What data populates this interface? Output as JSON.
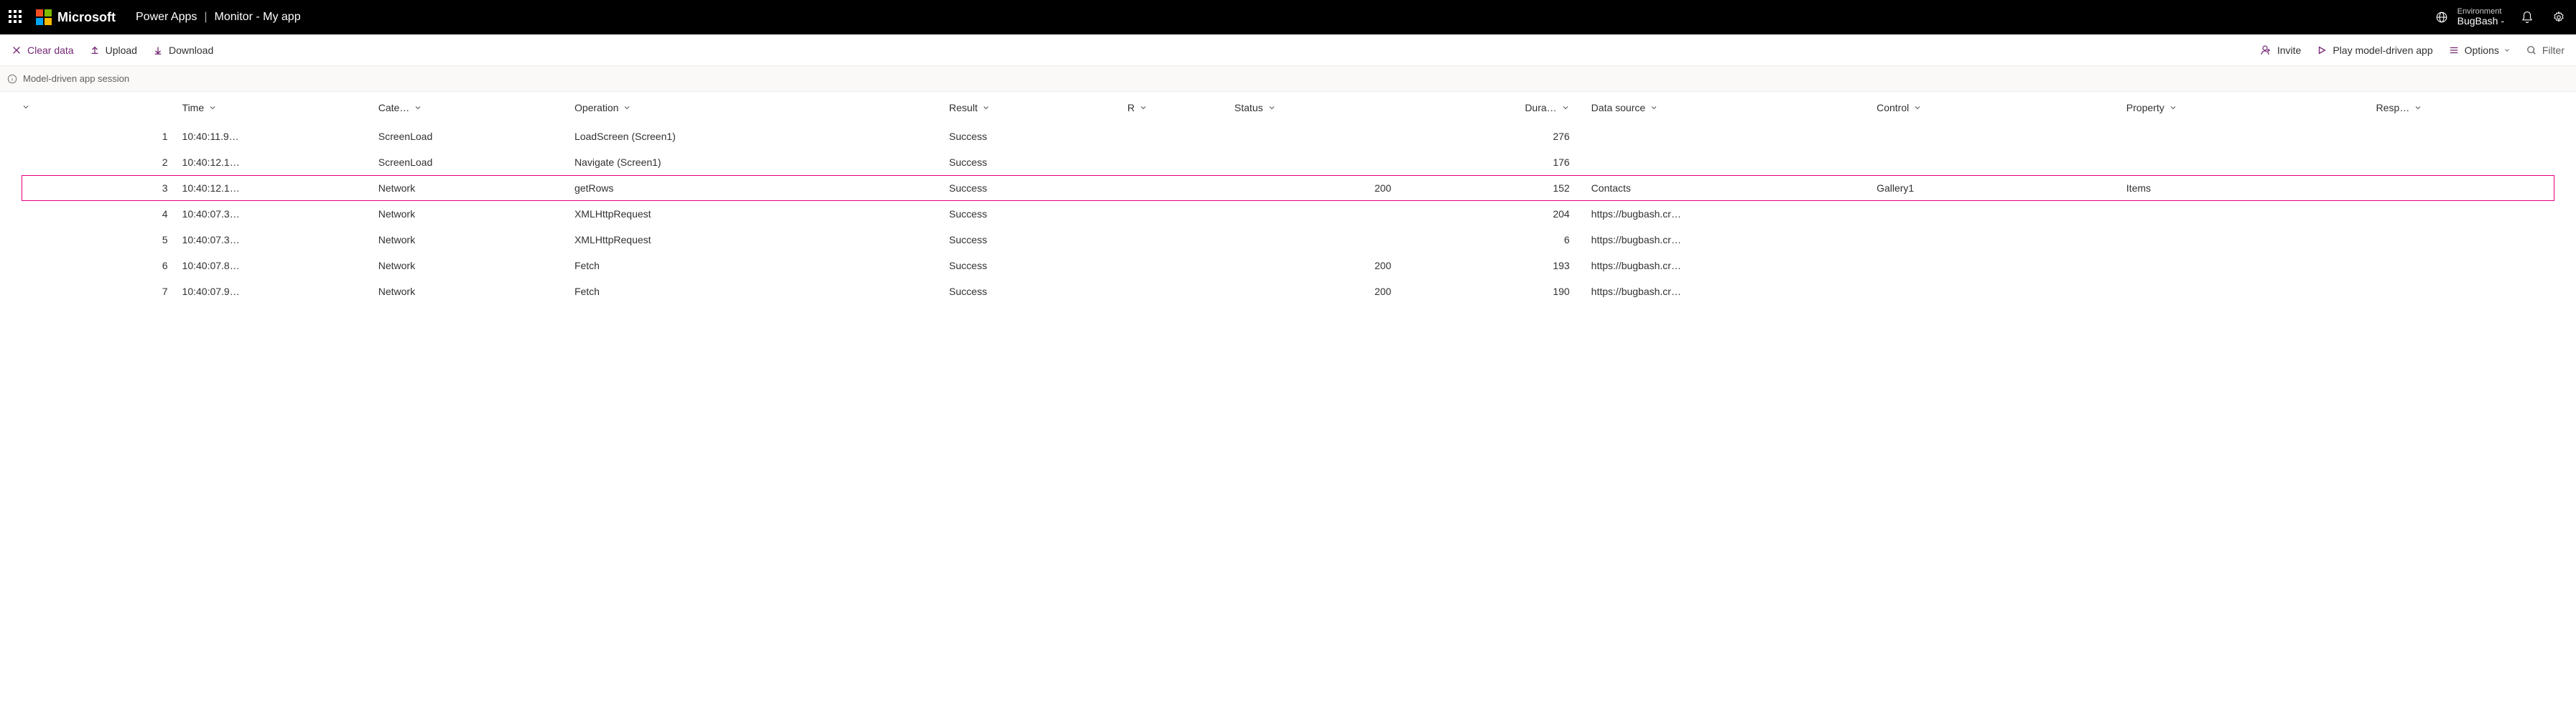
{
  "topbar": {
    "brand": "Microsoft",
    "app": "Power Apps",
    "page": "Monitor - My app",
    "env_label": "Environment",
    "env_name": "BugBash -"
  },
  "cmdbar": {
    "clear": "Clear data",
    "upload": "Upload",
    "download": "Download",
    "invite": "Invite",
    "play": "Play model-driven app",
    "options": "Options",
    "filter": "Filter"
  },
  "session": {
    "label": "Model-driven app session"
  },
  "table": {
    "headers": {
      "idx": "",
      "time": "Time",
      "category": "Cate…",
      "operation": "Operation",
      "result": "Result",
      "r": "R",
      "status": "Status",
      "duration": "Dura…",
      "datasource": "Data source",
      "control": "Control",
      "property": "Property",
      "response": "Resp…"
    },
    "rows": [
      {
        "idx": "1",
        "time": "10:40:11.9…",
        "category": "ScreenLoad",
        "operation": "LoadScreen (Screen1)",
        "result": "Success",
        "status": "",
        "duration": "276",
        "datasource": "",
        "control": "",
        "property": ""
      },
      {
        "idx": "2",
        "time": "10:40:12.1…",
        "category": "ScreenLoad",
        "operation": "Navigate (Screen1)",
        "result": "Success",
        "status": "",
        "duration": "176",
        "datasource": "",
        "control": "",
        "property": ""
      },
      {
        "idx": "3",
        "time": "10:40:12.1…",
        "category": "Network",
        "operation": "getRows",
        "result": "Success",
        "status": "200",
        "duration": "152",
        "datasource": "Contacts",
        "control": "Gallery1",
        "property": "Items",
        "highlight": true
      },
      {
        "idx": "4",
        "time": "10:40:07.3…",
        "category": "Network",
        "operation": "XMLHttpRequest",
        "result": "Success",
        "status": "",
        "duration": "204",
        "datasource": "https://bugbash.cr…",
        "control": "",
        "property": ""
      },
      {
        "idx": "5",
        "time": "10:40:07.3…",
        "category": "Network",
        "operation": "XMLHttpRequest",
        "result": "Success",
        "status": "",
        "duration": "6",
        "datasource": "https://bugbash.cr…",
        "control": "",
        "property": ""
      },
      {
        "idx": "6",
        "time": "10:40:07.8…",
        "category": "Network",
        "operation": "Fetch",
        "result": "Success",
        "status": "200",
        "duration": "193",
        "datasource": "https://bugbash.cr…",
        "control": "",
        "property": ""
      },
      {
        "idx": "7",
        "time": "10:40:07.9…",
        "category": "Network",
        "operation": "Fetch",
        "result": "Success",
        "status": "200",
        "duration": "190",
        "datasource": "https://bugbash.cr…",
        "control": "",
        "property": ""
      }
    ]
  }
}
